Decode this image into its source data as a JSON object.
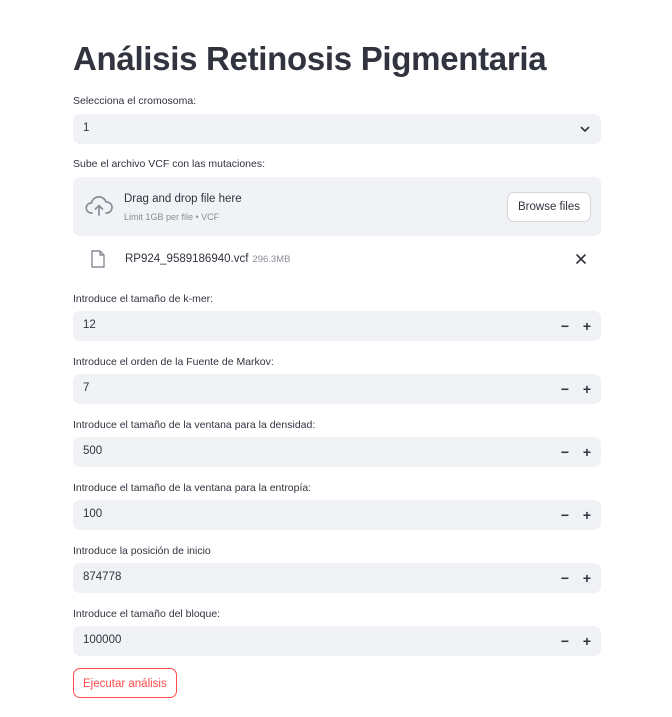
{
  "title": "Análisis Retinosis Pigmentaria",
  "chromosome": {
    "label": "Selecciona el cromosoma:",
    "value": "1"
  },
  "upload": {
    "label": "Sube el archivo VCF con las mutaciones:",
    "drop_text": "Drag and drop file here",
    "limit_text": "Limit 1GB per file • VCF",
    "browse_label": "Browse files",
    "file_name": "RP924_9589186940.vcf",
    "file_size": "296.3MB"
  },
  "fields": [
    {
      "label": "Introduce el tamaño de k-mer:",
      "value": "12"
    },
    {
      "label": "Introduce el orden de la Fuente de Markov:",
      "value": "7"
    },
    {
      "label": "Introduce el tamaño de la ventana para la densidad:",
      "value": "500"
    },
    {
      "label": "Introduce el tamaño de la ventana para la entropía:",
      "value": "100"
    },
    {
      "label": "Introduce la posición de inicio",
      "value": "874778"
    },
    {
      "label": "Introduce el tamaño del bloque:",
      "value": "100000"
    }
  ],
  "stepper": {
    "minus": "−",
    "plus": "+"
  },
  "run_button": "Ejecutar análisis",
  "colors": {
    "accent": "#ff4b4b",
    "input_bg": "#f0f2f6",
    "text": "#31333f"
  }
}
